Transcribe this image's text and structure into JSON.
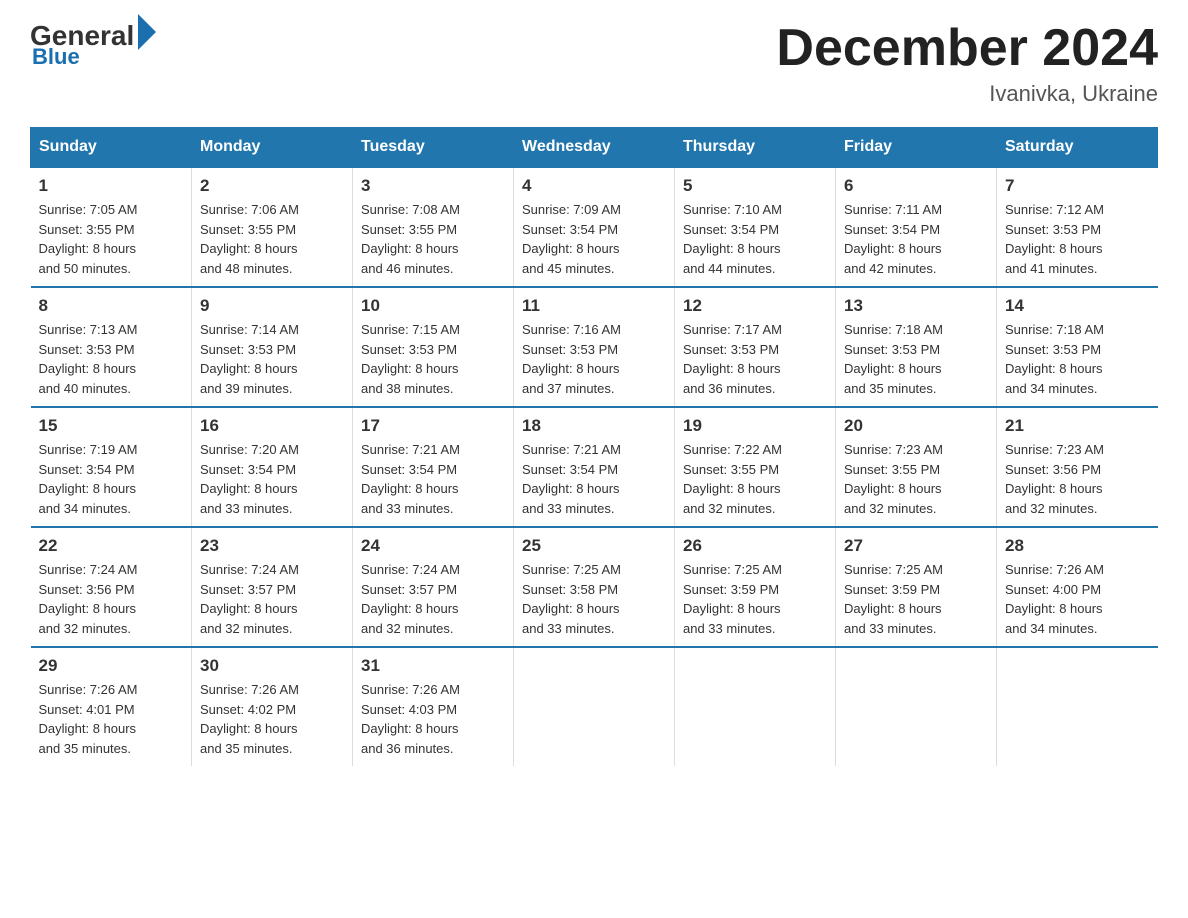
{
  "logo": {
    "general": "General",
    "blue": "Blue"
  },
  "title": "December 2024",
  "location": "Ivanivka, Ukraine",
  "days_of_week": [
    "Sunday",
    "Monday",
    "Tuesday",
    "Wednesday",
    "Thursday",
    "Friday",
    "Saturday"
  ],
  "weeks": [
    [
      {
        "day": "1",
        "sunrise": "7:05 AM",
        "sunset": "3:55 PM",
        "daylight": "8 hours and 50 minutes."
      },
      {
        "day": "2",
        "sunrise": "7:06 AM",
        "sunset": "3:55 PM",
        "daylight": "8 hours and 48 minutes."
      },
      {
        "day": "3",
        "sunrise": "7:08 AM",
        "sunset": "3:55 PM",
        "daylight": "8 hours and 46 minutes."
      },
      {
        "day": "4",
        "sunrise": "7:09 AM",
        "sunset": "3:54 PM",
        "daylight": "8 hours and 45 minutes."
      },
      {
        "day": "5",
        "sunrise": "7:10 AM",
        "sunset": "3:54 PM",
        "daylight": "8 hours and 44 minutes."
      },
      {
        "day": "6",
        "sunrise": "7:11 AM",
        "sunset": "3:54 PM",
        "daylight": "8 hours and 42 minutes."
      },
      {
        "day": "7",
        "sunrise": "7:12 AM",
        "sunset": "3:53 PM",
        "daylight": "8 hours and 41 minutes."
      }
    ],
    [
      {
        "day": "8",
        "sunrise": "7:13 AM",
        "sunset": "3:53 PM",
        "daylight": "8 hours and 40 minutes."
      },
      {
        "day": "9",
        "sunrise": "7:14 AM",
        "sunset": "3:53 PM",
        "daylight": "8 hours and 39 minutes."
      },
      {
        "day": "10",
        "sunrise": "7:15 AM",
        "sunset": "3:53 PM",
        "daylight": "8 hours and 38 minutes."
      },
      {
        "day": "11",
        "sunrise": "7:16 AM",
        "sunset": "3:53 PM",
        "daylight": "8 hours and 37 minutes."
      },
      {
        "day": "12",
        "sunrise": "7:17 AM",
        "sunset": "3:53 PM",
        "daylight": "8 hours and 36 minutes."
      },
      {
        "day": "13",
        "sunrise": "7:18 AM",
        "sunset": "3:53 PM",
        "daylight": "8 hours and 35 minutes."
      },
      {
        "day": "14",
        "sunrise": "7:18 AM",
        "sunset": "3:53 PM",
        "daylight": "8 hours and 34 minutes."
      }
    ],
    [
      {
        "day": "15",
        "sunrise": "7:19 AM",
        "sunset": "3:54 PM",
        "daylight": "8 hours and 34 minutes."
      },
      {
        "day": "16",
        "sunrise": "7:20 AM",
        "sunset": "3:54 PM",
        "daylight": "8 hours and 33 minutes."
      },
      {
        "day": "17",
        "sunrise": "7:21 AM",
        "sunset": "3:54 PM",
        "daylight": "8 hours and 33 minutes."
      },
      {
        "day": "18",
        "sunrise": "7:21 AM",
        "sunset": "3:54 PM",
        "daylight": "8 hours and 33 minutes."
      },
      {
        "day": "19",
        "sunrise": "7:22 AM",
        "sunset": "3:55 PM",
        "daylight": "8 hours and 32 minutes."
      },
      {
        "day": "20",
        "sunrise": "7:23 AM",
        "sunset": "3:55 PM",
        "daylight": "8 hours and 32 minutes."
      },
      {
        "day": "21",
        "sunrise": "7:23 AM",
        "sunset": "3:56 PM",
        "daylight": "8 hours and 32 minutes."
      }
    ],
    [
      {
        "day": "22",
        "sunrise": "7:24 AM",
        "sunset": "3:56 PM",
        "daylight": "8 hours and 32 minutes."
      },
      {
        "day": "23",
        "sunrise": "7:24 AM",
        "sunset": "3:57 PM",
        "daylight": "8 hours and 32 minutes."
      },
      {
        "day": "24",
        "sunrise": "7:24 AM",
        "sunset": "3:57 PM",
        "daylight": "8 hours and 32 minutes."
      },
      {
        "day": "25",
        "sunrise": "7:25 AM",
        "sunset": "3:58 PM",
        "daylight": "8 hours and 33 minutes."
      },
      {
        "day": "26",
        "sunrise": "7:25 AM",
        "sunset": "3:59 PM",
        "daylight": "8 hours and 33 minutes."
      },
      {
        "day": "27",
        "sunrise": "7:25 AM",
        "sunset": "3:59 PM",
        "daylight": "8 hours and 33 minutes."
      },
      {
        "day": "28",
        "sunrise": "7:26 AM",
        "sunset": "4:00 PM",
        "daylight": "8 hours and 34 minutes."
      }
    ],
    [
      {
        "day": "29",
        "sunrise": "7:26 AM",
        "sunset": "4:01 PM",
        "daylight": "8 hours and 35 minutes."
      },
      {
        "day": "30",
        "sunrise": "7:26 AM",
        "sunset": "4:02 PM",
        "daylight": "8 hours and 35 minutes."
      },
      {
        "day": "31",
        "sunrise": "7:26 AM",
        "sunset": "4:03 PM",
        "daylight": "8 hours and 36 minutes."
      },
      null,
      null,
      null,
      null
    ]
  ],
  "labels": {
    "sunrise": "Sunrise:",
    "sunset": "Sunset:",
    "daylight": "Daylight:"
  }
}
